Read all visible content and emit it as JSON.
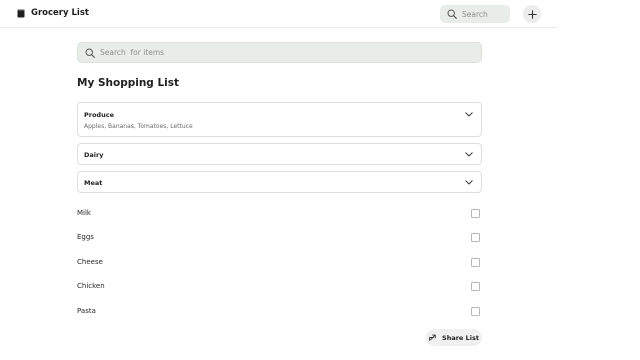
{
  "app": {
    "title": "Grocery List",
    "icon": "document-icon"
  },
  "header": {
    "search_placeholder": "Search",
    "search_icon": "search-icon",
    "add_icon": "plus-icon"
  },
  "main": {
    "search_placeholder": "Search  for items",
    "title": "My Shopping List",
    "categories": [
      {
        "name": "Produce",
        "items": "Apples, Bananas, Tomatoes, Lettuce",
        "expanded": true
      },
      {
        "name": "Dairy",
        "items": "",
        "expanded": false
      },
      {
        "name": "Meat",
        "items": "",
        "expanded": false
      }
    ],
    "items": [
      {
        "name": "Milk",
        "checked": false
      },
      {
        "name": "Eggs",
        "checked": false
      },
      {
        "name": "Cheese",
        "checked": false
      },
      {
        "name": "Chicken",
        "checked": false
      },
      {
        "name": "Pasta",
        "checked": false
      }
    ],
    "share_label": "Share List",
    "share_icon": "share-icon"
  },
  "colors": {
    "search_bg": "#e9ede9",
    "border": "#dedede",
    "text": "#1f1f1f"
  }
}
